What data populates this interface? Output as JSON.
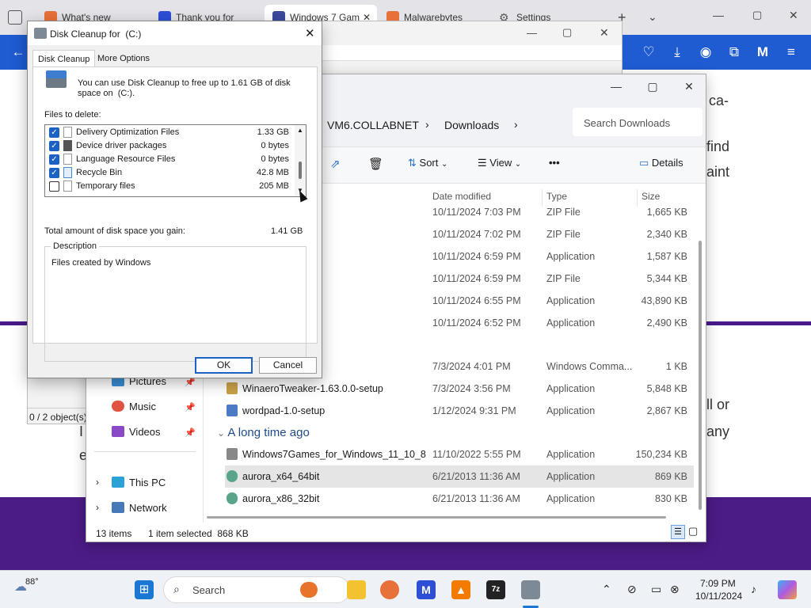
{
  "browser": {
    "tabs": [
      {
        "label": "What's new"
      },
      {
        "label": "Thank you for"
      },
      {
        "label": "Windows 7 Gam"
      },
      {
        "label": "Malwarebytes"
      },
      {
        "label": "Settings"
      }
    ],
    "page_text": {
      "t1": "ca-",
      "t2": "find",
      "t3": "aint",
      "t4": "ll or",
      "t5": "any",
      "t6": "I",
      "t7": "e"
    }
  },
  "back_window": {
    "status": "0 / 2 object(s)"
  },
  "explorer": {
    "breadcrumb": [
      "VM6.COLLABNET",
      "Downloads"
    ],
    "search_placeholder": "Search Downloads",
    "toolbar": {
      "sort": "Sort",
      "view": "View",
      "more": "•••",
      "details": "Details"
    },
    "columns": {
      "date": "Date modified",
      "type": "Type",
      "size": "Size"
    },
    "rows_top": [
      {
        "date": "10/11/2024 7:03 PM",
        "type": "ZIP File",
        "size": "1,665 KB"
      },
      {
        "date": "10/11/2024 7:02 PM",
        "type": "ZIP File",
        "size": "2,340 KB"
      },
      {
        "date": "10/11/2024 6:59 PM",
        "type": "Application",
        "size": "1,587 KB"
      },
      {
        "date": "10/11/2024 6:59 PM",
        "type": "ZIP File",
        "size": "5,344 KB"
      },
      {
        "date": "10/11/2024 6:55 PM",
        "type": "Application",
        "size": "43,890 KB"
      },
      {
        "date": "10/11/2024 6:52 PM",
        "type": "Application",
        "size": "2,490 KB"
      }
    ],
    "rows_mid": [
      {
        "name": "",
        "date": "7/3/2024 4:01 PM",
        "type": "Windows Comma...",
        "size": "1 KB"
      },
      {
        "name": "WinaeroTweaker-1.63.0.0-setup",
        "date": "7/3/2024 3:56 PM",
        "type": "Application",
        "size": "5,848 KB"
      },
      {
        "name": "wordpad-1.0-setup",
        "date": "1/12/2024 9:31 PM",
        "type": "Application",
        "size": "2,867 KB"
      }
    ],
    "group_label": "A long time ago",
    "rows_old": [
      {
        "name": "Windows7Games_for_Windows_11_10_8",
        "date": "11/10/2022 5:55 PM",
        "type": "Application",
        "size": "150,234 KB"
      },
      {
        "name": "aurora_x64_64bit",
        "date": "6/21/2013 11:36 AM",
        "type": "Application",
        "size": "869 KB"
      },
      {
        "name": "aurora_x86_32bit",
        "date": "6/21/2013 11:36 AM",
        "type": "Application",
        "size": "830 KB"
      }
    ],
    "sidebar": {
      "pictures": "Pictures",
      "music": "Music",
      "videos": "Videos",
      "this_pc": "This PC",
      "network": "Network"
    },
    "status": {
      "items": "13 items",
      "selected": "1 item selected  868 KB"
    }
  },
  "dialog": {
    "title": "Disk Cleanup for  (C:)",
    "tabs": [
      "Disk Cleanup",
      "More Options"
    ],
    "intro": "You can use Disk Cleanup to free up to 1.61 GB of disk space on  (C:).",
    "files_label": "Files to delete:",
    "files": [
      {
        "name": "Delivery Optimization Files",
        "size": "1.33 GB",
        "checked": true
      },
      {
        "name": "Device driver packages",
        "size": "0 bytes",
        "checked": true
      },
      {
        "name": "Language Resource Files",
        "size": "0 bytes",
        "checked": true
      },
      {
        "name": "Recycle Bin",
        "size": "42.8 MB",
        "checked": true
      },
      {
        "name": "Temporary files",
        "size": "205 MB",
        "checked": false
      }
    ],
    "total_label": "Total amount of disk space you gain:",
    "total_value": "1.41 GB",
    "description_label": "Description",
    "description_text": "Files created by Windows",
    "ok": "OK",
    "cancel": "Cancel"
  },
  "taskbar": {
    "weather": "88°",
    "search": "Search",
    "time": "7:09 PM",
    "date": "10/11/2024"
  }
}
